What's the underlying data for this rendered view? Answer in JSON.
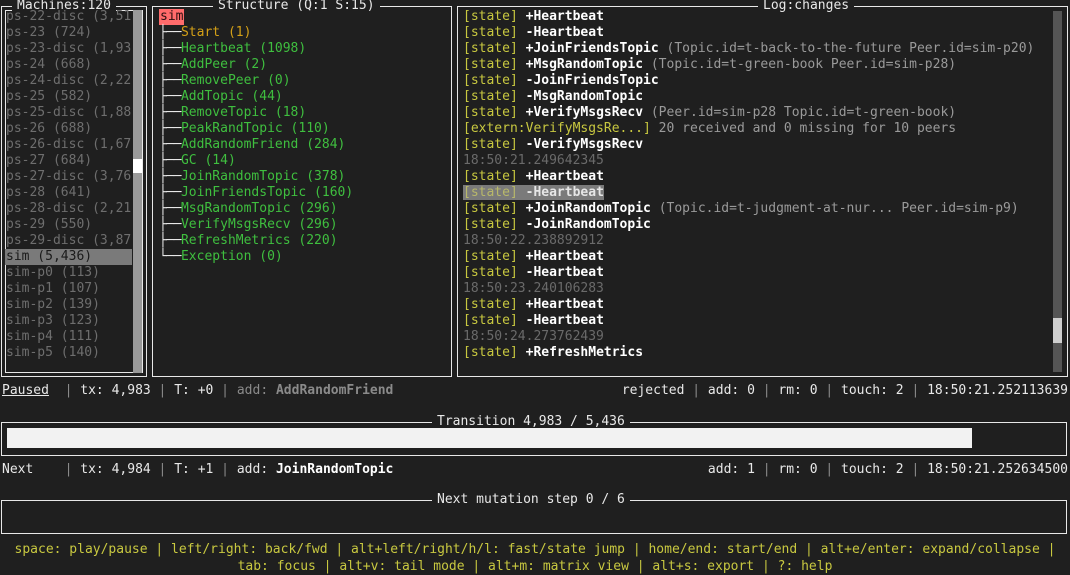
{
  "panels": {
    "machines": {
      "title": "Machines:120"
    },
    "structure": {
      "title": "Structure (Q:1 S:15)"
    },
    "log": {
      "title": "Log:changes"
    },
    "transition": {
      "title": "Transition 4,983 / 5,436",
      "progress_percent": 91.6
    },
    "mutation": {
      "title": "Next mutation step 0 / 6"
    }
  },
  "machines": {
    "items": [
      {
        "label": "ps-22-disc (3,51",
        "selected": false
      },
      {
        "label": "ps-23 (724)",
        "selected": false
      },
      {
        "label": "ps-23-disc (1,93",
        "selected": false
      },
      {
        "label": "ps-24 (668)",
        "selected": false
      },
      {
        "label": "ps-24-disc (2,22",
        "selected": false
      },
      {
        "label": "ps-25 (582)",
        "selected": false
      },
      {
        "label": "ps-25-disc (1,88",
        "selected": false
      },
      {
        "label": "ps-26 (688)",
        "selected": false
      },
      {
        "label": "ps-26-disc (1,67",
        "selected": false
      },
      {
        "label": "ps-27 (684)",
        "selected": false
      },
      {
        "label": "ps-27-disc (3,76",
        "selected": false
      },
      {
        "label": "ps-28 (641)",
        "selected": false
      },
      {
        "label": "ps-28-disc (2,21",
        "selected": false
      },
      {
        "label": "ps-29 (550)",
        "selected": false
      },
      {
        "label": "ps-29-disc (3,87",
        "selected": false
      },
      {
        "label": "sim (5,436)",
        "selected": true
      },
      {
        "label": "sim-p0 (113)",
        "selected": false
      },
      {
        "label": "sim-p1 (107)",
        "selected": false
      },
      {
        "label": "sim-p2 (139)",
        "selected": false
      },
      {
        "label": "sim-p3 (123)",
        "selected": false
      },
      {
        "label": "sim-p4 (111)",
        "selected": false
      },
      {
        "label": "sim-p5 (140)",
        "selected": false
      }
    ],
    "scrollbar": {
      "thumb_top_percent": 41,
      "thumb_height_percent": 4
    }
  },
  "structure": {
    "root": "sim",
    "nodes": [
      {
        "label": "Start (1)",
        "color": "gold"
      },
      {
        "label": "Heartbeat (1098)",
        "color": "green"
      },
      {
        "label": "AddPeer (2)",
        "color": "green"
      },
      {
        "label": "RemovePeer (0)",
        "color": "green"
      },
      {
        "label": "AddTopic (44)",
        "color": "green"
      },
      {
        "label": "RemoveTopic (18)",
        "color": "green"
      },
      {
        "label": "PeakRandTopic (110)",
        "color": "green"
      },
      {
        "label": "AddRandomFriend (284)",
        "color": "green"
      },
      {
        "label": "GC (14)",
        "color": "green"
      },
      {
        "label": "JoinRandomTopic (378)",
        "color": "green"
      },
      {
        "label": "JoinFriendsTopic (160)",
        "color": "green"
      },
      {
        "label": "MsgRandomTopic (296)",
        "color": "green"
      },
      {
        "label": "VerifyMsgsRecv (296)",
        "color": "green"
      },
      {
        "label": "RefreshMetrics (220)",
        "color": "green"
      },
      {
        "label": "Exception (0)",
        "color": "green"
      }
    ]
  },
  "log": {
    "rows": [
      {
        "kind": "state",
        "prefix": "[state]",
        "msg": "+Heartbeat",
        "detail": ""
      },
      {
        "kind": "state",
        "prefix": "[state]",
        "msg": "-Heartbeat",
        "detail": ""
      },
      {
        "kind": "state",
        "prefix": "[state]",
        "msg": "+JoinFriendsTopic",
        "detail": "(Topic.id=t-back-to-the-future Peer.id=sim-p20)"
      },
      {
        "kind": "state",
        "prefix": "[state]",
        "msg": "+MsgRandomTopic",
        "detail": "(Topic.id=t-green-book Peer.id=sim-p28)"
      },
      {
        "kind": "state",
        "prefix": "[state]",
        "msg": "-JoinFriendsTopic",
        "detail": ""
      },
      {
        "kind": "state",
        "prefix": "[state]",
        "msg": "-MsgRandomTopic",
        "detail": ""
      },
      {
        "kind": "state",
        "prefix": "[state]",
        "msg": "+VerifyMsgsRecv",
        "detail": "(Peer.id=sim-p28 Topic.id=t-green-book)"
      },
      {
        "kind": "extern",
        "prefix": "[extern:VerifyMsgsRe...]",
        "msg": "20 received and 0 missing for 10 peers",
        "detail": ""
      },
      {
        "kind": "state",
        "prefix": "[state]",
        "msg": "-VerifyMsgsRecv",
        "detail": ""
      },
      {
        "kind": "timestamp",
        "prefix": "",
        "msg": "18:50:21.249642345",
        "detail": ""
      },
      {
        "kind": "state",
        "prefix": "[state]",
        "msg": "+Heartbeat",
        "detail": ""
      },
      {
        "kind": "state",
        "prefix": "[state]",
        "msg": "-Heartbeat",
        "detail": "",
        "highlighted": true
      },
      {
        "kind": "state",
        "prefix": "[state]",
        "msg": "+JoinRandomTopic",
        "detail": "(Topic.id=t-judgment-at-nur... Peer.id=sim-p9)"
      },
      {
        "kind": "state",
        "prefix": "[state]",
        "msg": "-JoinRandomTopic",
        "detail": ""
      },
      {
        "kind": "timestamp",
        "prefix": "",
        "msg": "18:50:22.238892912",
        "detail": ""
      },
      {
        "kind": "state",
        "prefix": "[state]",
        "msg": "+Heartbeat",
        "detail": ""
      },
      {
        "kind": "state",
        "prefix": "[state]",
        "msg": "-Heartbeat",
        "detail": ""
      },
      {
        "kind": "timestamp",
        "prefix": "",
        "msg": "18:50:23.240106283",
        "detail": ""
      },
      {
        "kind": "state",
        "prefix": "[state]",
        "msg": "+Heartbeat",
        "detail": ""
      },
      {
        "kind": "state",
        "prefix": "[state]",
        "msg": "-Heartbeat",
        "detail": ""
      },
      {
        "kind": "timestamp",
        "prefix": "",
        "msg": "18:50:24.273762439",
        "detail": ""
      },
      {
        "kind": "state",
        "prefix": "[state]",
        "msg": "+RefreshMetrics",
        "detail": ""
      }
    ],
    "scrollbar": {
      "thumb_top_percent": 85,
      "thumb_height_percent": 7
    }
  },
  "status_current": {
    "state": "Paused",
    "tx_label": "tx:",
    "tx_value": "4,983",
    "t_label": "T:",
    "t_value": "+0",
    "add_label": "add:",
    "add_value": "AddRandomFriend",
    "rejected": "rejected",
    "r_add_label": "add:",
    "r_add_value": "0",
    "rm_label": "rm:",
    "rm_value": "0",
    "touch_label": "touch:",
    "touch_value": "2",
    "time": "18:50:21.252113639"
  },
  "status_next": {
    "state": "Next",
    "tx_label": "tx:",
    "tx_value": "4,984",
    "t_label": "T:",
    "t_value": "+1",
    "add_label": "add:",
    "add_value": "JoinRandomTopic",
    "r_add_label": "add:",
    "r_add_value": "1",
    "rm_label": "rm:",
    "rm_value": "0",
    "touch_label": "touch:",
    "touch_value": "2",
    "time": "18:50:21.252634500"
  },
  "help": {
    "line1": "space: play/pause | left/right: back/fwd | alt+left/right/h/l: fast/state jump | home/end: start/end | alt+e/enter: expand/collapse |",
    "line2": "tab: focus | alt+v: tail mode | alt+m: matrix view | alt+s: export | ?: help"
  },
  "colors": {
    "background": "#1f1f1f",
    "border": "#e8e8e8",
    "accent_green": "#3fbf3f",
    "accent_gold": "#d4a017",
    "accent_yellow": "#c8c840",
    "root_badge": "#ff6b6b",
    "selection": "#7a7a7a"
  }
}
